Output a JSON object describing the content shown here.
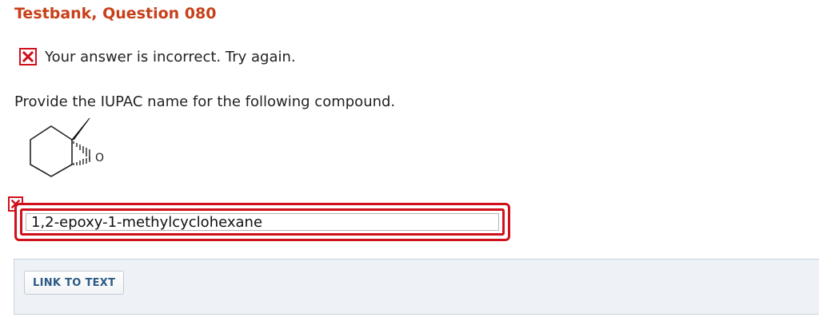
{
  "header": {
    "title": "Testbank, Question 080"
  },
  "feedback": {
    "message": "Your answer is incorrect.  Try again.",
    "icon": "x-mark-icon"
  },
  "question": {
    "prompt": "Provide the IUPAC name for the following compound."
  },
  "structure": {
    "oxygen_label": "O"
  },
  "answer": {
    "value": "1,2-epoxy-1-methylcyclohexane",
    "status_icon": "x-mark-icon"
  },
  "panel": {
    "link_label": "LINK TO TEXT"
  },
  "colors": {
    "title": "#c8401a",
    "error": "#d0101a",
    "link": "#2c5a85",
    "panel_bg": "#eef2f6"
  }
}
